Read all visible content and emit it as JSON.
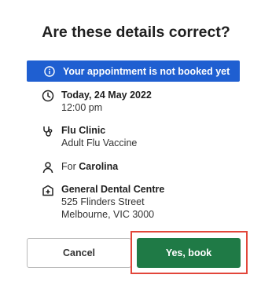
{
  "dialog": {
    "title": "Are these details correct?",
    "banner": {
      "text": "Your appointment is not booked yet",
      "icon": "info-icon",
      "color": "#1f5fd1"
    },
    "details": {
      "datetime": {
        "icon": "clock-icon",
        "date": "Today, 24 May 2022",
        "time": "12:00 pm"
      },
      "service": {
        "icon": "stethoscope-icon",
        "clinic": "Flu Clinic",
        "type": "Adult Flu Vaccine"
      },
      "patient": {
        "icon": "person-icon",
        "prefix": "For",
        "name": "Carolina"
      },
      "location": {
        "icon": "clinic-building-icon",
        "name": "General Dental Centre",
        "street": "525 Flinders Street",
        "city": "Melbourne, VIC 3000"
      }
    },
    "buttons": {
      "cancel_label": "Cancel",
      "confirm_label": "Yes, book",
      "confirm_color": "#1f7a46",
      "highlight_color": "#e2463a"
    }
  }
}
